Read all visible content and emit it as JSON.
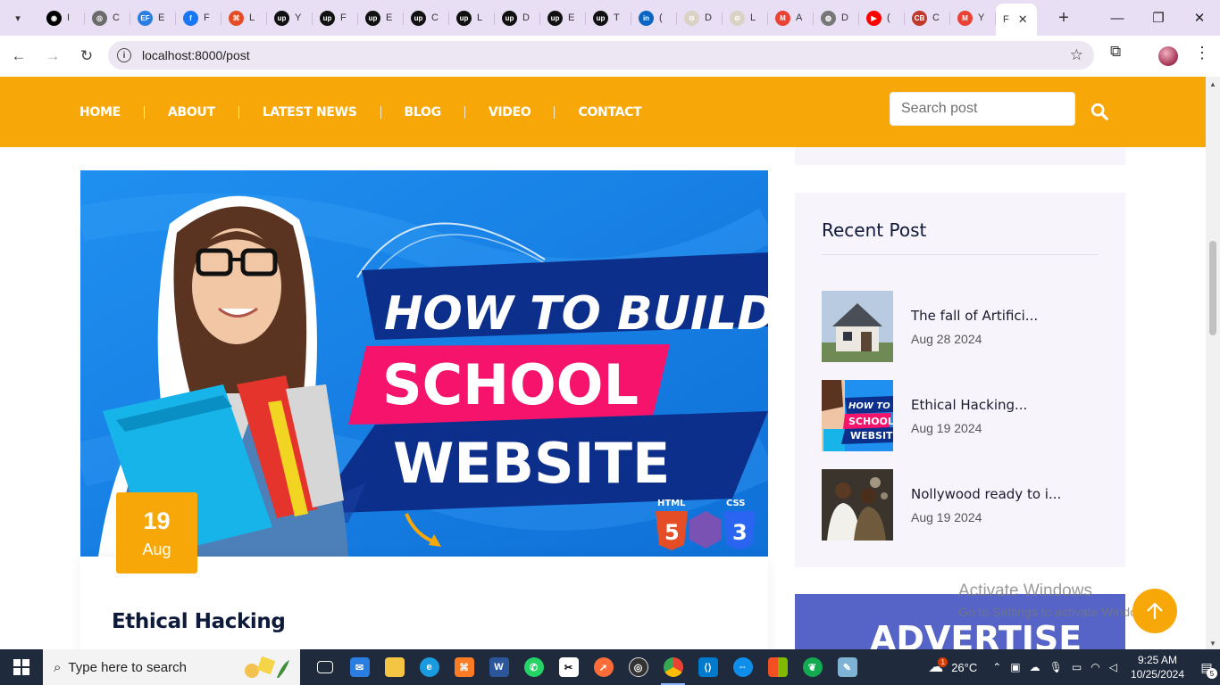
{
  "browser": {
    "tabs": [
      {
        "label": "I",
        "color": "#000000",
        "glyph": "◉"
      },
      {
        "label": "C",
        "color": "#6b6b6b",
        "glyph": "◎"
      },
      {
        "label": "E",
        "color": "#2a7de1",
        "glyph": "EF"
      },
      {
        "label": "F",
        "color": "#1877f2",
        "glyph": "f"
      },
      {
        "label": "L",
        "color": "#e44d26",
        "glyph": "⌘"
      },
      {
        "label": "Y",
        "color": "#111111",
        "glyph": "up"
      },
      {
        "label": "F",
        "color": "#111111",
        "glyph": "up"
      },
      {
        "label": "E",
        "color": "#111111",
        "glyph": "up"
      },
      {
        "label": "C",
        "color": "#111111",
        "glyph": "up"
      },
      {
        "label": "L",
        "color": "#111111",
        "glyph": "up"
      },
      {
        "label": "D",
        "color": "#111111",
        "glyph": "up"
      },
      {
        "label": "E",
        "color": "#111111",
        "glyph": "up"
      },
      {
        "label": "T",
        "color": "#111111",
        "glyph": "up"
      },
      {
        "label": "(",
        "color": "#0a66c2",
        "glyph": "in"
      },
      {
        "label": "D",
        "color": "#d9d2c5",
        "glyph": "⊖"
      },
      {
        "label": "L",
        "color": "#d9d2c5",
        "glyph": "⊖"
      },
      {
        "label": "A",
        "color": "#ea4335",
        "glyph": "M"
      },
      {
        "label": "D",
        "color": "#777777",
        "glyph": "◍"
      },
      {
        "label": "(",
        "color": "#ff0000",
        "glyph": "▶"
      },
      {
        "label": "C",
        "color": "#c0392b",
        "glyph": "CB"
      },
      {
        "label": "Y",
        "color": "#ea4335",
        "glyph": "M"
      }
    ],
    "active_tab": {
      "label": "F",
      "close": "✕"
    },
    "new_tab": "+",
    "window_controls": {
      "minimize": "—",
      "maximize": "❐",
      "close": "✕"
    },
    "url": "localhost:8000/post"
  },
  "site": {
    "nav": [
      "HOME",
      "ABOUT",
      "LATEST NEWS",
      "BLOG",
      "VIDEO",
      "CONTACT"
    ],
    "search_placeholder": "Search post",
    "accent": "#f7a707"
  },
  "post": {
    "hero": {
      "line1": "HOW TO BUILD",
      "line2": "SCHOOL",
      "line3": "WEBSITE",
      "badge_html": "HTML",
      "badge_css": "CSS"
    },
    "date_day": "19",
    "date_month": "Aug",
    "title": "Ethical Hacking"
  },
  "sidebar": {
    "recent_heading": "Recent Post",
    "recent": [
      {
        "title": "The fall of Artifici...",
        "date": "Aug 28 2024"
      },
      {
        "title": "Ethical Hacking...",
        "date": "Aug 19 2024"
      },
      {
        "title": "Nollywood ready to i...",
        "date": "Aug 19 2024"
      }
    ],
    "advert": "ADVERTISE"
  },
  "watermark": {
    "line1": "Activate Windows",
    "line2": "Go to Settings to activate Windows."
  },
  "taskbar": {
    "search_placeholder": "Type here to search",
    "weather": "26°C",
    "weather_badge": "1",
    "time": "9:25 AM",
    "date": "10/25/2024",
    "notifications": "5"
  }
}
